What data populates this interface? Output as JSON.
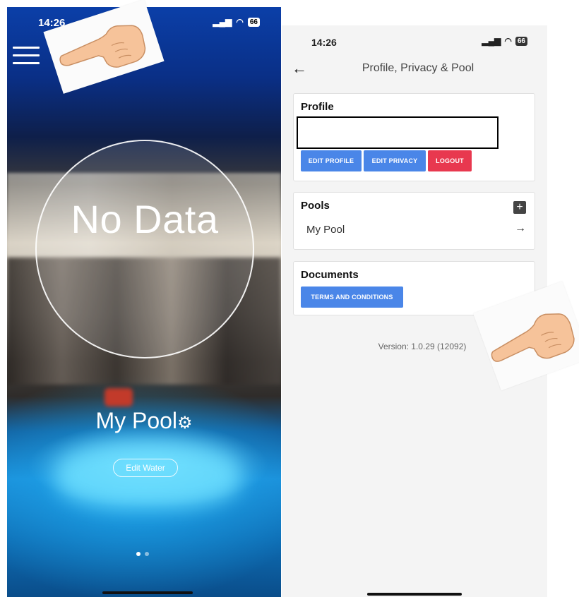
{
  "left_screen": {
    "status": {
      "time": "14:26",
      "battery": "66"
    },
    "circle_text": "No Data",
    "pool_name": "My Pool",
    "edit_label": "Edit Water"
  },
  "right_screen": {
    "status": {
      "time": "14:26",
      "battery": "66"
    },
    "title": "Profile, Privacy & Pool",
    "profile": {
      "heading": "Profile",
      "buttons": [
        "EDIT PROFILE",
        "EDIT PRIVACY",
        "LOGOUT"
      ]
    },
    "pools": {
      "heading": "Pools",
      "items": [
        {
          "label": "My Pool"
        }
      ]
    },
    "documents": {
      "heading": "Documents",
      "button": "TERMS AND CONDITIONS"
    },
    "version": "Version: 1.0.29 (12092)"
  },
  "colors": {
    "primary_button": "#4a86e8",
    "danger_button": "#e8384f",
    "screen_bg": "#f4f4f4"
  },
  "icons": [
    "hamburger-menu-icon",
    "gear-icon",
    "back-arrow-icon",
    "plus-icon",
    "arrow-right-icon",
    "pointing-hand-icon"
  ]
}
